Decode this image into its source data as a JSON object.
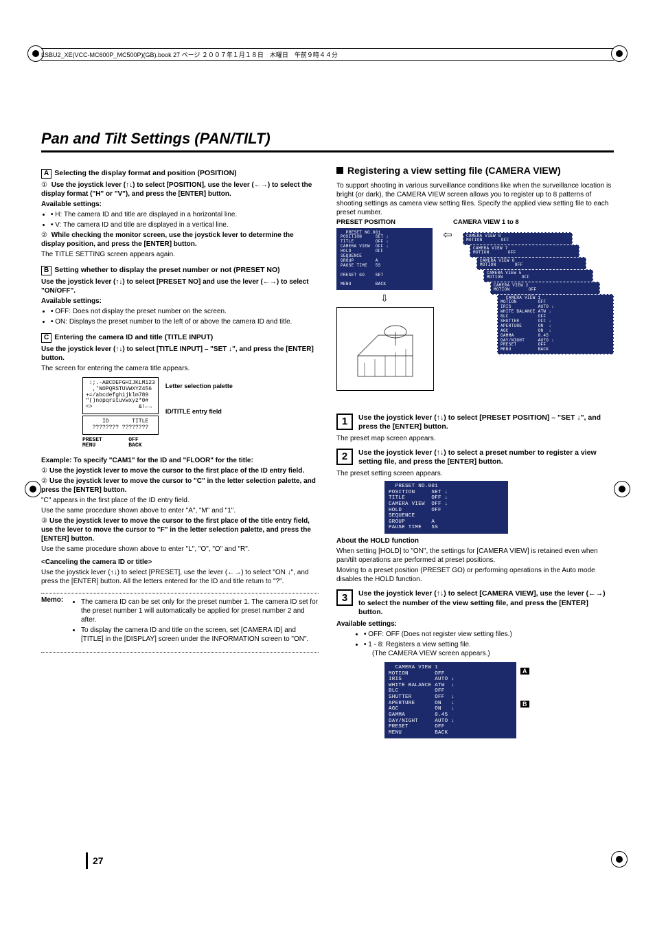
{
  "header_line": "LSBU2_XE(VCC-MC600P_MC500P)(GB).book  27 ページ  ２００７年１月１８日　木曜日　午前９時４４分",
  "main_title": "Pan and Tilt Settings (PAN/TILT)",
  "page_number": "27",
  "left": {
    "A": {
      "head": "Selecting the display format and position (POSITION)",
      "s1": "Use the joystick lever (↑↓) to select [POSITION], use the lever (←→) to select the display format (\"H\" or \"V\"), and press the [ENTER] button.",
      "avail": "Available settings:",
      "h_item": "H:  The camera ID and title are displayed in a horizontal line.",
      "v_item": "V:  The camera ID and title are displayed in a vertical line.",
      "s2": "While checking the monitor screen, use the joystick lever to determine the display position, and press the [ENTER] button.",
      "s2_after": "The TITLE SETTING screen appears again."
    },
    "B": {
      "head": "Setting whether to display the preset number or not (PRESET NO)",
      "line1": "Use the joystick lever (↑↓) to select [PRESET NO] and use the lever (←→) to select \"ON/OFF\".",
      "avail": "Available settings:",
      "off": "OFF:  Does not display the preset number on the screen.",
      "on": "ON:   Displays the preset number to the left of or above the camera ID and title."
    },
    "C": {
      "head": "Entering the camera ID and title (TITLE INPUT)",
      "line1": "Use the joystick lever (↑↓) to select [TITLE INPUT] – \"SET ↓\", and press the [ENTER] button.",
      "line2": "The screen for entering the camera title appears.",
      "palette_lines": " :;.-ABCDEFGHIJKLM123\n  ,'NOPQRSTUVWXYZ456\n+=/abcdefghijklm789\n\"()nopqrstuvwxyz*0#\n<>              &!←→",
      "id_title_row": "   ID       TITLE\n???????? ????????",
      "preset_row": "PRESET        OFF\nMENU          BACK",
      "lbl1": "Letter selection palette",
      "lbl2": "ID/TITLE entry field",
      "example": "Example: To specify \"CAM1\" for the ID and \"FLOOR\" for the title:",
      "ex1": "Use the joystick lever to move the cursor to the first place of the ID entry field.",
      "ex2a": "Use the joystick lever to move the cursor to \"C\" in the letter selection palette, and press the [ENTER] button.",
      "ex2b": "\"C\" appears in the first place of the ID entry field.",
      "ex2c": "Use the same procedure shown above to enter \"A\", \"M\" and \"1\".",
      "ex3a": "Use the joystick lever to move the cursor to the first place of the title entry field, use the lever to move the cursor to \"F\" in the letter selection palette, and press the [ENTER] button.",
      "ex3b": "Use the same procedure shown above to enter \"L\", \"O\", \"O\" and \"R\".",
      "cancel_head": "<Canceling the camera ID or title>",
      "cancel_body": "Use the joystick lever (↑↓) to select [PRESET], use the lever (←→) to select \"ON ↓\", and press the [ENTER] button. All the letters entered for the ID and title return to \"?\"."
    },
    "memo": {
      "label": "Memo:",
      "m1": "The camera ID can be set only for the preset number 1. The camera ID set for the preset number 1 will automatically be applied for preset number 2 and after.",
      "m2": "To display the camera ID and title on the screen, set [CAMERA ID] and [TITLE] in the [DISPLAY] screen under the INFORMATION screen to \"ON\"."
    }
  },
  "right": {
    "sub_title": "Registering a view setting file (CAMERA VIEW)",
    "intro": "To support shooting in various surveillance conditions like when the surveillance location is bright (or dark), the CAMERA VIEW screen allows you to register up to 8 patterns of shooting settings as camera view setting files. Specify the applied view setting file to each preset number.",
    "osd_header_left": "PRESET POSITION",
    "osd_header_right": "CAMERA VIEW 1 to 8",
    "preset_osd": "  PRESET NO.001\nPOSITION     SET ↓\nTITLE        OFF ↓\nCAMERA VIEW  OFF ↓\nHOLD         OFF\nSEQUENCE\nGROUP        A\nPAUSE TIME   5S\n\nPRESET GO    SET\n\nMENU         BACK",
    "camera_view_1": "  CAMERA VIEW 1\nMOTION        OFF\nIRIS          AUTO ↓\nWHITE BALANCE ATW ↓\nBLC           OFF\nSHUTTER       OFF ↓\nAPERTURE      ON  ↓\nAGC           ON  ↓\nGAMMA         0.45\nDAY/NIGHT     AUTO ↓\nPRESET        OFF\nMENU          BACK",
    "step1": {
      "num": "1",
      "text": "Use the joystick lever (↑↓) to select [PRESET POSITION] – \"SET ↓\", and press the [ENTER] button.",
      "after": "The preset map screen appears."
    },
    "step2": {
      "num": "2",
      "text": "Use the joystick lever (↑↓) to select a preset number to register a view setting file, and press the [ENTER] button.",
      "after": "The preset setting screen appears.",
      "osd": "  PRESET NO.001\nPOSITION     SET ↓\nTITLE        OFF ↓\nCAMERA VIEW  OFF ↓\nHOLD         OFF\nSEQUENCE\nGROUP        A\nPAUSE TIME   5S",
      "hold_head": "About the HOLD function",
      "hold1": "When setting [HOLD] to \"ON\", the settings for [CAMERA VIEW] is retained even when pan/tilt operations are performed at preset positions.",
      "hold2": "Moving to a preset position (PRESET GO) or performing operations in the Auto mode disables the HOLD function."
    },
    "step3": {
      "num": "3",
      "text": "Use the joystick lever (↑↓) to select [CAMERA VIEW], use the lever (←→) to select the number of the view setting file, and press the [ENTER] button.",
      "avail": "Available settings:",
      "off": "OFF: OFF (Does not register view setting files.)",
      "oneeight": "1 - 8: Registers a view setting file.",
      "oneeight_sub": "(The CAMERA VIEW screen appears.)",
      "osd": "  CAMERA VIEW 1\nMOTION        OFF\nIRIS          AUTO ↓\nWHITE BALANCE ATW  ↓\nBLC           OFF\nSHUTTER       OFF  ↓\nAPERTURE      ON   ↓\nAGC           ON   ↓\nGAMMA         0.45\nDAY/NIGHT     AUTO ↓\nPRESET        OFF\nMENU          BACK",
      "labelA": "A",
      "labelB": "B"
    },
    "stack_labels": {
      "v8": "CAMERA VIEW 8",
      "v7": "CAMERA VIEW 7",
      "v6": "CAMERA VIEW 6",
      "v5": "CAMERA VIEW 5",
      "v2": "CAMERA VIEW 2",
      "mot": "MOTION       OFF"
    }
  }
}
